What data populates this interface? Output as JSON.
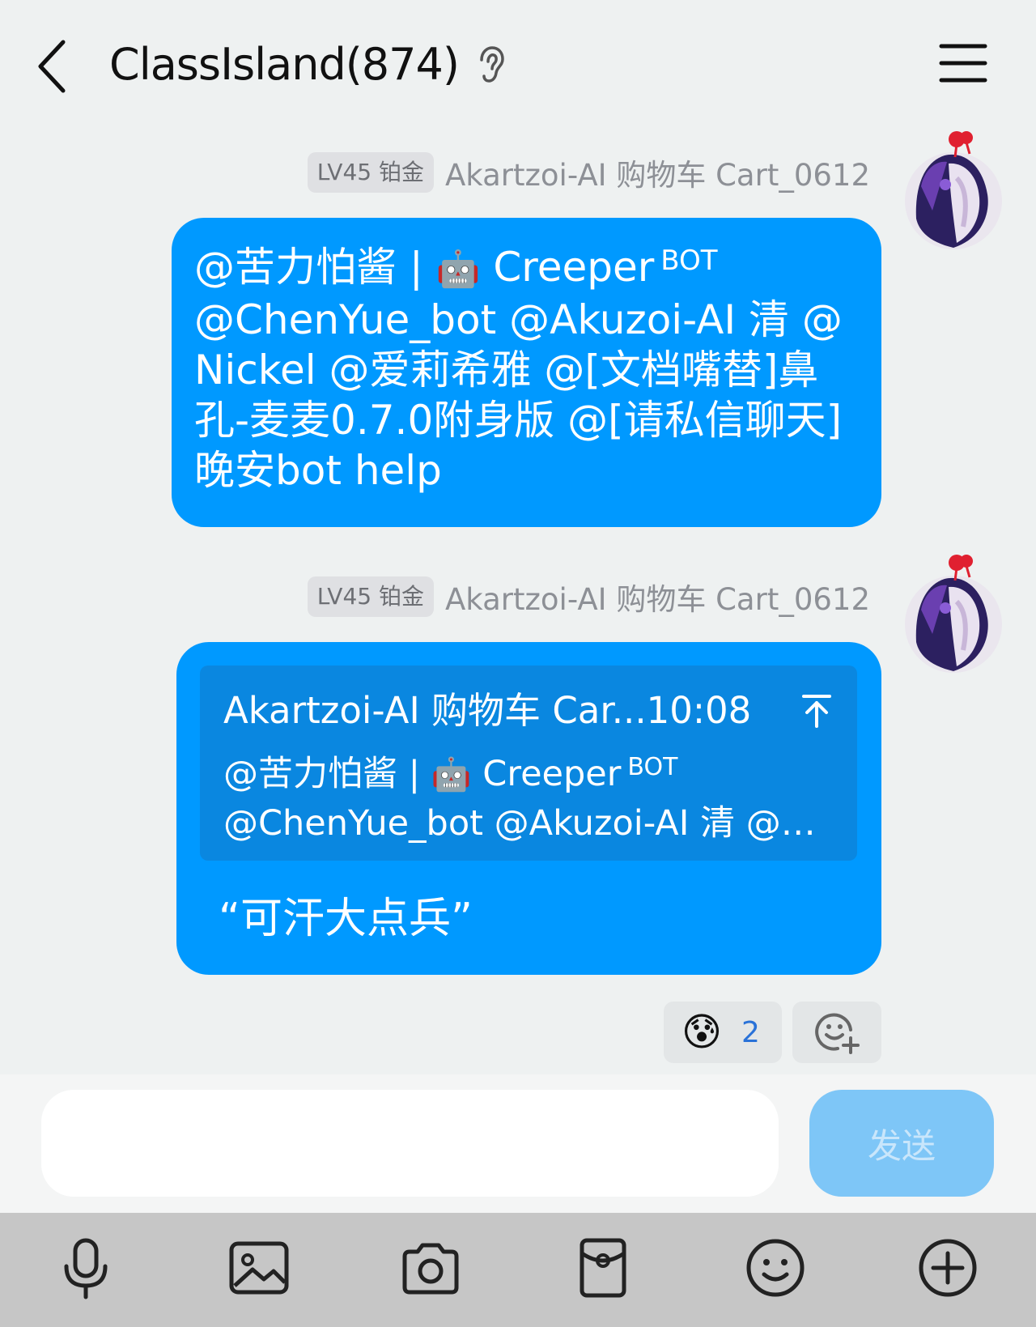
{
  "header": {
    "title": "ClassIsland(874)",
    "icons": {
      "back": "chevron-left-icon",
      "ear": "ear-icon",
      "menu": "hamburger-menu-icon"
    }
  },
  "messages": [
    {
      "level_badge": "LV45 铂金",
      "sender": "Akartzoi-AI 购物车 Cart_0612",
      "text_line1_prefix": "@苦力怕酱 | ",
      "robot_emoji": "🤖",
      "text_line1_suffix": " Creeper",
      "bot_tag": "BOT",
      "text_rest": "@ChenYue_bot @Akuzoi-AI 清 @Nickel @爱莉希雅 @[文档嘴替]鼻孔-麦麦0.7.0附身版 @[请私信聊天]晚安bot help"
    },
    {
      "level_badge": "LV45 铂金",
      "sender": "Akartzoi-AI 购物车 Cart_0612",
      "quote": {
        "header": "Akartzoi-AI 购物车 Car...10:08",
        "line1_prefix": "@苦力怕酱 | ",
        "robot_emoji": "🤖",
        "line1_suffix": " Creeper",
        "bot_tag": "BOT",
        "line2": "@ChenYue_bot @Akuzoi-AI 清 @…"
      },
      "reply_text": "“可汗大点兵”",
      "reactions": [
        {
          "emoji": "😰",
          "count": "2"
        }
      ]
    }
  ],
  "input": {
    "value": "",
    "placeholder": "",
    "send_label": "发送"
  },
  "toolbar": {
    "items": [
      "microphone-icon",
      "image-icon",
      "camera-icon",
      "red-packet-icon",
      "smiley-icon",
      "plus-circle-icon"
    ]
  },
  "colors": {
    "background": "#eef1f1",
    "bubble": "#0099ff",
    "quote_box": "#0a87e0",
    "send_button": "#7ec6f7",
    "toolbar": "#c6c6c6",
    "reaction_count": "#2a72d8"
  }
}
